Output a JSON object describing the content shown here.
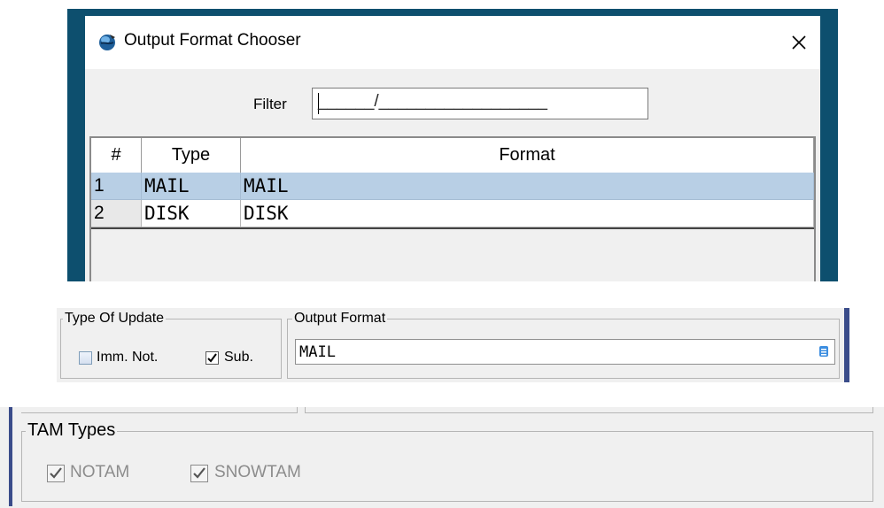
{
  "dialog": {
    "title": "Output Format Chooser",
    "filter_label": "Filter",
    "filter_mask": "______/__________________",
    "columns": [
      "#",
      "Type",
      "Format"
    ],
    "rows": [
      {
        "num": "1",
        "type": "MAIL",
        "format": "MAIL",
        "selected": true
      },
      {
        "num": "2",
        "type": "DISK",
        "format": "DISK",
        "selected": false
      }
    ],
    "selection_color": "#b8cfe5"
  },
  "update_panel": {
    "type_of_update_legend": "Type Of Update",
    "imm_not_label": "Imm. Not.",
    "imm_not_checked": false,
    "sub_label": "Sub.",
    "sub_checked": true,
    "output_format_legend": "Output Format",
    "output_format_value": "MAIL"
  },
  "tam_panel": {
    "legend": "TAM Types",
    "notam_label": "NOTAM",
    "notam_checked": true,
    "snowtam_label": "SNOWTAM",
    "snowtam_checked": true,
    "disabled": true
  },
  "icons": {
    "app": "globe-icon",
    "close": "close-icon",
    "list": "list-chooser-icon",
    "check": "checkmark-icon"
  }
}
